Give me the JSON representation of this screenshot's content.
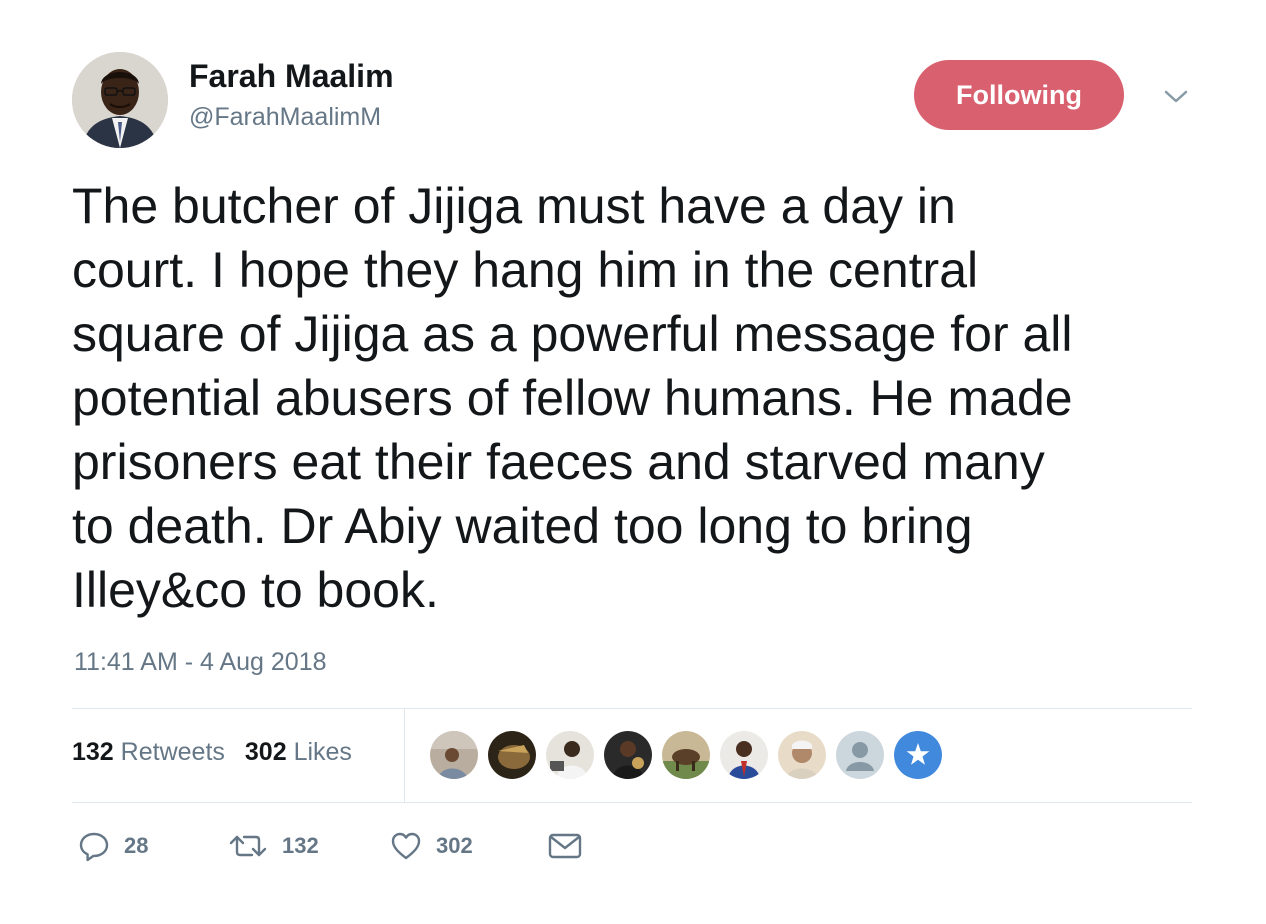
{
  "author": {
    "display_name": "Farah Maalim",
    "handle": "@FarahMaalimM",
    "avatar_icon": "user-photo-avatar"
  },
  "follow_button": {
    "label": "Following",
    "color": "#d9606f"
  },
  "tweet": {
    "lines": [
      "The butcher of Jijiga must have a day in",
      "court. I hope they hang him in the central",
      "square of Jijiga as a powerful message for all",
      "potential abusers of fellow humans. He made",
      "prisoners eat their faeces and starved many",
      "to death. Dr Abiy waited too long to bring",
      "Illey&co to book."
    ],
    "timestamp": "11:41 AM - 4 Aug 2018"
  },
  "stats": {
    "retweets_count": "132",
    "retweets_label": "Retweets",
    "likes_count": "302",
    "likes_label": "Likes"
  },
  "likers": [
    {
      "icon": "liker-avatar-1",
      "color": "#a89b8c"
    },
    {
      "icon": "liker-avatar-2",
      "color": "#5a4a32"
    },
    {
      "icon": "liker-avatar-3",
      "color": "#7a6a5c"
    },
    {
      "icon": "liker-avatar-4",
      "color": "#2a2a2a"
    },
    {
      "icon": "liker-avatar-5",
      "color": "#7d6a4a"
    },
    {
      "icon": "liker-avatar-6",
      "color": "#d8d0c6"
    },
    {
      "icon": "liker-avatar-7",
      "color": "#c7b49a"
    },
    {
      "icon": "default-avatar",
      "color": "#c5ccd3"
    },
    {
      "icon": "somalia-flag-avatar",
      "color": "#4189dd"
    }
  ],
  "actions": {
    "reply_count": "28",
    "retweet_count": "132",
    "like_count": "302"
  },
  "colors": {
    "text": "#14171a",
    "secondary": "#657786",
    "divider": "#e1e8ed"
  }
}
